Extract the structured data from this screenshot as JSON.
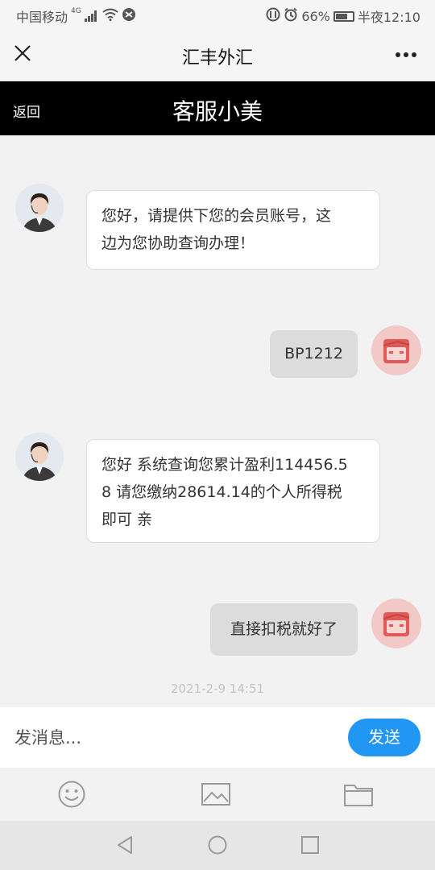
{
  "status_bar": {
    "carrier": "中国移动",
    "network": "4G",
    "battery": "66%",
    "time": "半夜12:10"
  },
  "titlebar": {
    "title": "汇丰外汇"
  },
  "chat_header": {
    "back_label": "返回",
    "agent_name": "客服小美"
  },
  "messages": [
    {
      "from": "agent",
      "text_lines": [
        "您好，请提供下您的会员账号，这",
        "边为您协助查询办理！"
      ]
    },
    {
      "from": "user",
      "text": "BP1212"
    },
    {
      "from": "agent",
      "text_lines": [
        "您好 系统查询您累计盈利114456.5",
        "8 请您缴纳28614.14的个人所得税",
        "即可 亲"
      ]
    },
    {
      "from": "user",
      "text": "直接扣税就好了"
    }
  ],
  "timestamp": "2021-2-9 14:51",
  "input": {
    "placeholder": "发消息...",
    "send_label": "发送"
  },
  "colors": {
    "header_bg": "#000000",
    "send_button": "#2196f3",
    "user_avatar_bg": "#f2c9c7",
    "user_avatar_icon": "#e05a5a"
  }
}
